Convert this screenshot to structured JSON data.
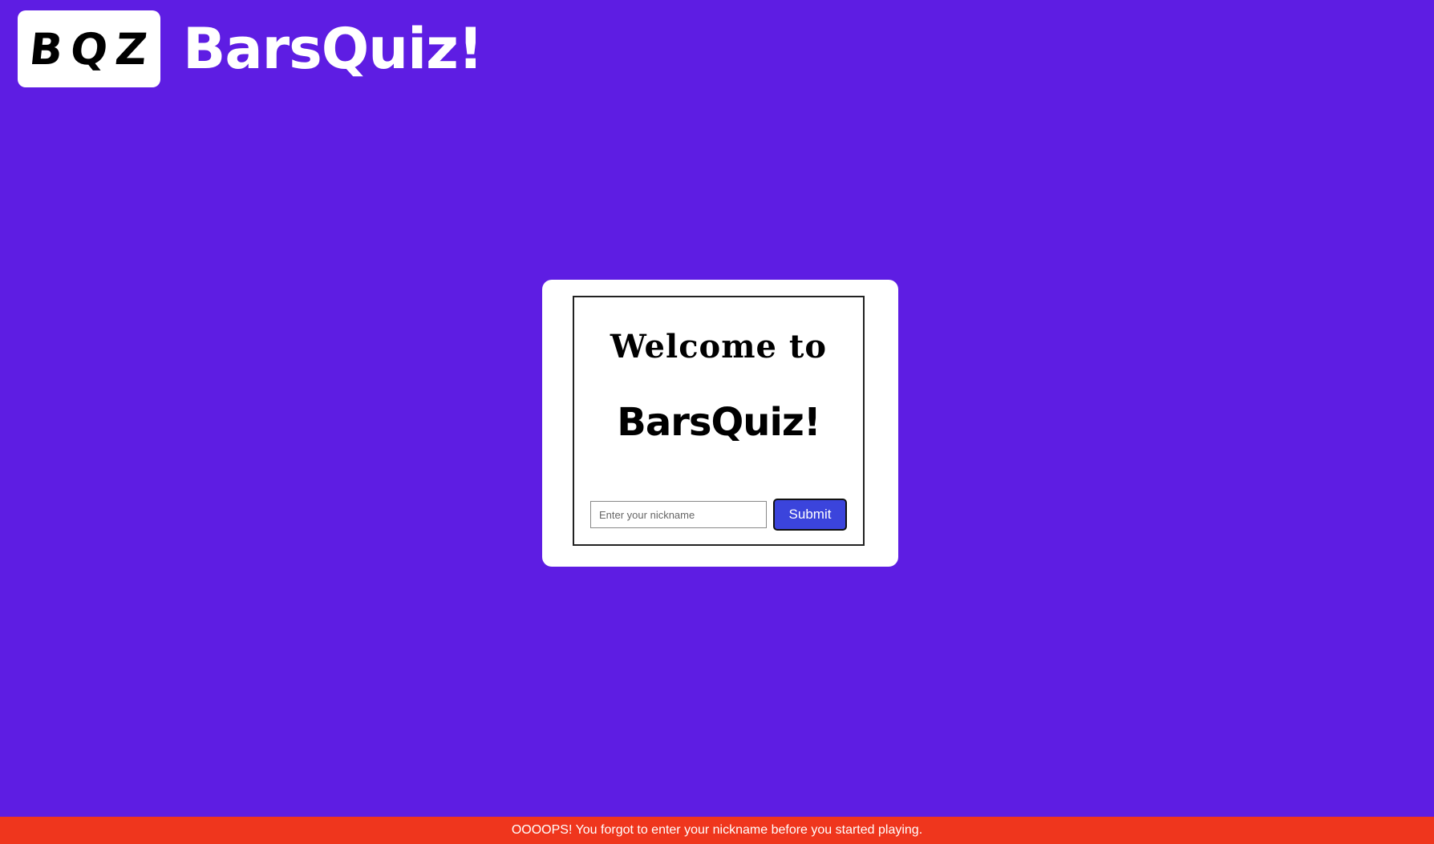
{
  "header": {
    "logo_text": "BQZ",
    "brand_title": "BarsQuiz!"
  },
  "card": {
    "welcome_text": "Welcome to",
    "brand_text": "BarsQuiz!",
    "nickname_input": {
      "placeholder": "Enter your nickname",
      "value": ""
    },
    "submit_label": "Submit"
  },
  "error_bar": {
    "message": "OOOOPS! You forgot to enter your nickname before you started playing."
  },
  "colors": {
    "background": "#5e1de3",
    "submit_button": "#3b44dc",
    "error_bar": "#ef361d"
  }
}
